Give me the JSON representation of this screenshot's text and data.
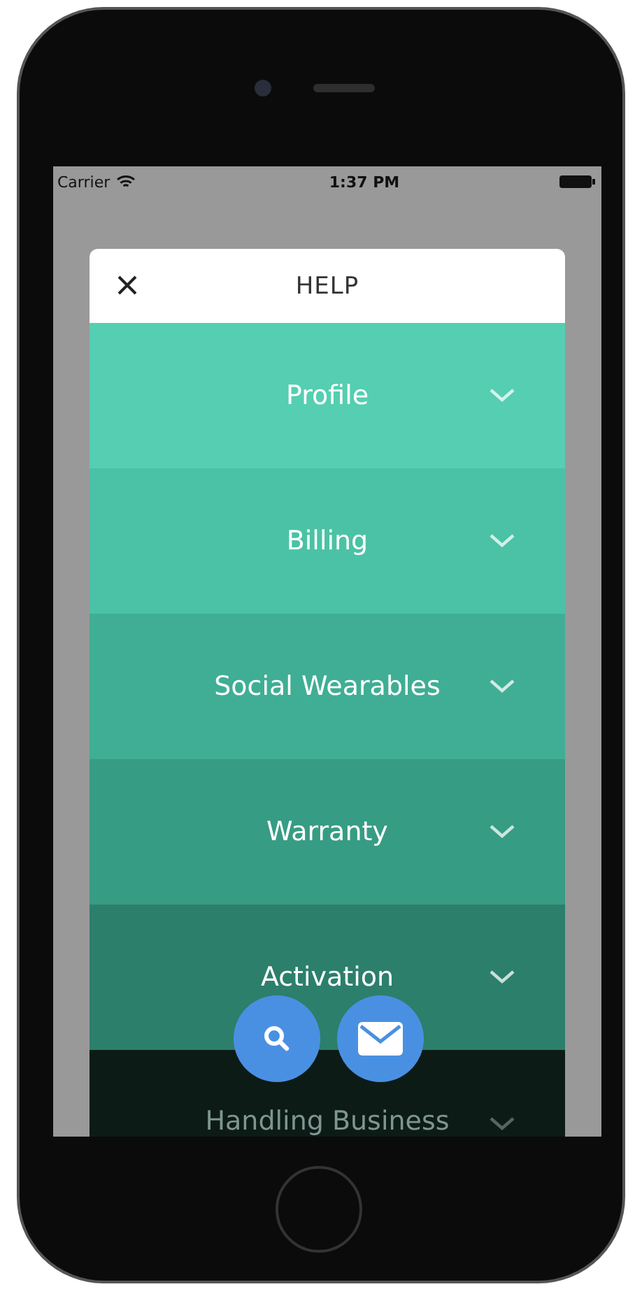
{
  "status_bar": {
    "carrier": "Carrier",
    "time": "1:37 PM"
  },
  "dialog": {
    "title": "HELP"
  },
  "topics": [
    {
      "label": "Profile",
      "expanded": false
    },
    {
      "label": "Billing",
      "expanded": false
    },
    {
      "label": "Social Wearables",
      "expanded": false
    },
    {
      "label": "Warranty",
      "expanded": false
    },
    {
      "label": "Activation",
      "expanded": false
    },
    {
      "label": "Handling Business",
      "expanded": false
    }
  ]
}
